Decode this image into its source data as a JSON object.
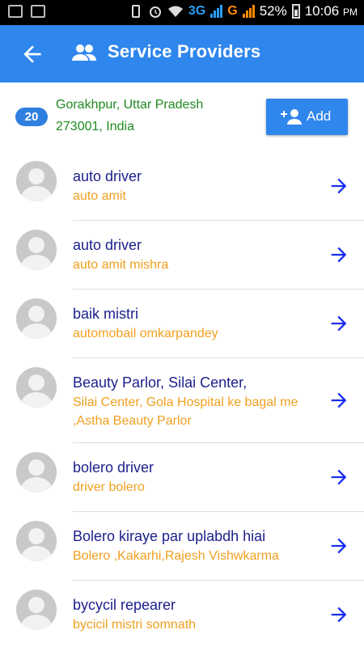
{
  "status_bar": {
    "net1": "3G",
    "net2": "G",
    "battery": "52%",
    "time": "10:06",
    "ampm": "PM"
  },
  "app_bar": {
    "title": "Service Providers"
  },
  "location": {
    "count": "20",
    "line1": "Gorakhpur, Uttar Pradesh",
    "line2": "273001, India",
    "add_label": "Add"
  },
  "providers": [
    {
      "title": "auto driver",
      "subtitle": "auto amit"
    },
    {
      "title": "auto driver",
      "subtitle": "auto amit mishra"
    },
    {
      "title": "baik mistri",
      "subtitle": "automobail omkarpandey"
    },
    {
      "title": "Beauty Parlor, Silai Center,",
      "subtitle": "Silai Center, Gola Hospital ke bagal me ,Astha Beauty Parlor"
    },
    {
      "title": "bolero driver",
      "subtitle": "driver bolero"
    },
    {
      "title": "Bolero kiraye par uplabdh hiai",
      "subtitle": "Bolero ,Kakarhi,Rajesh Vishwkarma"
    },
    {
      "title": "bycycil repearer",
      "subtitle": "bycicil mistri somnath"
    }
  ],
  "colors": {
    "app_bar": "#2f86ec",
    "title_text": "#1b1f8a",
    "subtitle_text": "#f0a020",
    "location_text": "#1f8a1f",
    "arrow": "#1a2ef0"
  }
}
